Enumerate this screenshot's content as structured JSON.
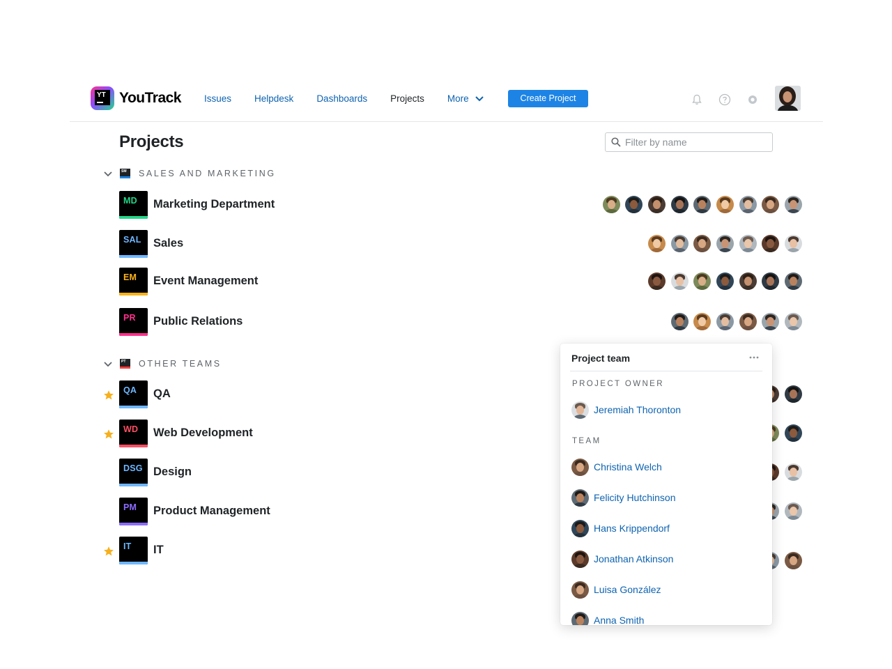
{
  "header": {
    "logo_text": "YouTrack",
    "logo_mark": "YT",
    "nav": [
      {
        "label": "Issues"
      },
      {
        "label": "Helpdesk"
      },
      {
        "label": "Dashboards"
      },
      {
        "label": "Projects"
      },
      {
        "label": "More"
      }
    ],
    "create_button": "Create Project",
    "icons": [
      "bell-icon",
      "help-icon",
      "settings-icon"
    ]
  },
  "page": {
    "title": "Projects",
    "filter_placeholder": "Filter by name"
  },
  "groups": [
    {
      "label": "SALES AND MARKETING",
      "icon_text": "SM",
      "color": "#1d84e5",
      "projects": [
        {
          "abbr": "MD",
          "name": "Marketing Department",
          "accent": "#21d789",
          "starred": false,
          "member_count": 9
        },
        {
          "abbr": "SAL",
          "name": "Sales",
          "accent": "#6fb7ff",
          "starred": false,
          "member_count": 7
        },
        {
          "abbr": "EM",
          "name": "Event Management",
          "accent": "#fcb316",
          "starred": false,
          "member_count": 7
        },
        {
          "abbr": "PR",
          "name": "Public Relations",
          "accent": "#ff318c",
          "starred": false,
          "member_count": 6
        }
      ]
    },
    {
      "label": "OTHER TEAMS",
      "icon_text": "PT",
      "color": "#ff3b3b",
      "projects": [
        {
          "abbr": "QA",
          "name": "QA",
          "accent": "#6fb7ff",
          "starred": true,
          "member_count": 2
        },
        {
          "abbr": "WD",
          "name": "Web Development",
          "accent": "#ff4e63",
          "starred": true,
          "member_count": 2
        },
        {
          "abbr": "DSG",
          "name": "Design",
          "accent": "#6fb7ff",
          "starred": false,
          "member_count": 2
        },
        {
          "abbr": "PM",
          "name": "Product Management",
          "accent": "#8c6dff",
          "starred": false,
          "member_count": 2
        },
        {
          "abbr": "IT",
          "name": "IT",
          "accent": "#6fb7ff",
          "starred": true,
          "member_count": 2
        }
      ]
    }
  ],
  "popup": {
    "title": "Project team",
    "owner_label": "PROJECT OWNER",
    "owner": "Jeremiah Thoronton",
    "team_label": "TEAM",
    "team": [
      "Christina Welch",
      "Felicity Hutchinson",
      "Hans Krippendorf",
      "Jonathan Atkinson",
      "Luisa González",
      "Anna Smith"
    ]
  },
  "colors": {
    "link": "#0e63b0",
    "button": "#1d84e5",
    "star": "#f6b01e"
  }
}
